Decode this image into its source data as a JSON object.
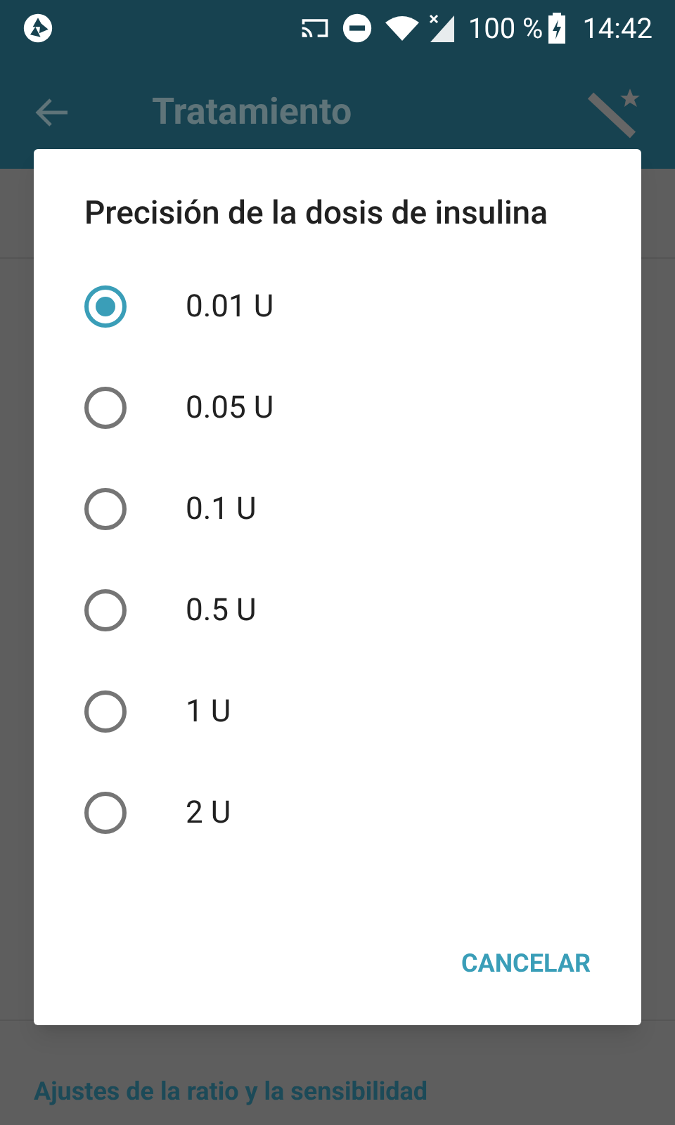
{
  "status_bar": {
    "battery": "100 %",
    "time": "14:42"
  },
  "app_bar": {
    "title": "Tratamiento"
  },
  "background": {
    "section_header": "Ajustes de la ratio y la sensibilidad"
  },
  "dialog": {
    "title": "Precisión de la dosis de insulina",
    "options": [
      {
        "label": "0.01 U",
        "selected": true
      },
      {
        "label": "0.05 U",
        "selected": false
      },
      {
        "label": "0.1 U",
        "selected": false
      },
      {
        "label": "0.5 U",
        "selected": false
      },
      {
        "label": "1 U",
        "selected": false
      },
      {
        "label": "2 U",
        "selected": false
      }
    ],
    "buttons": [
      "CANCELAR"
    ]
  }
}
